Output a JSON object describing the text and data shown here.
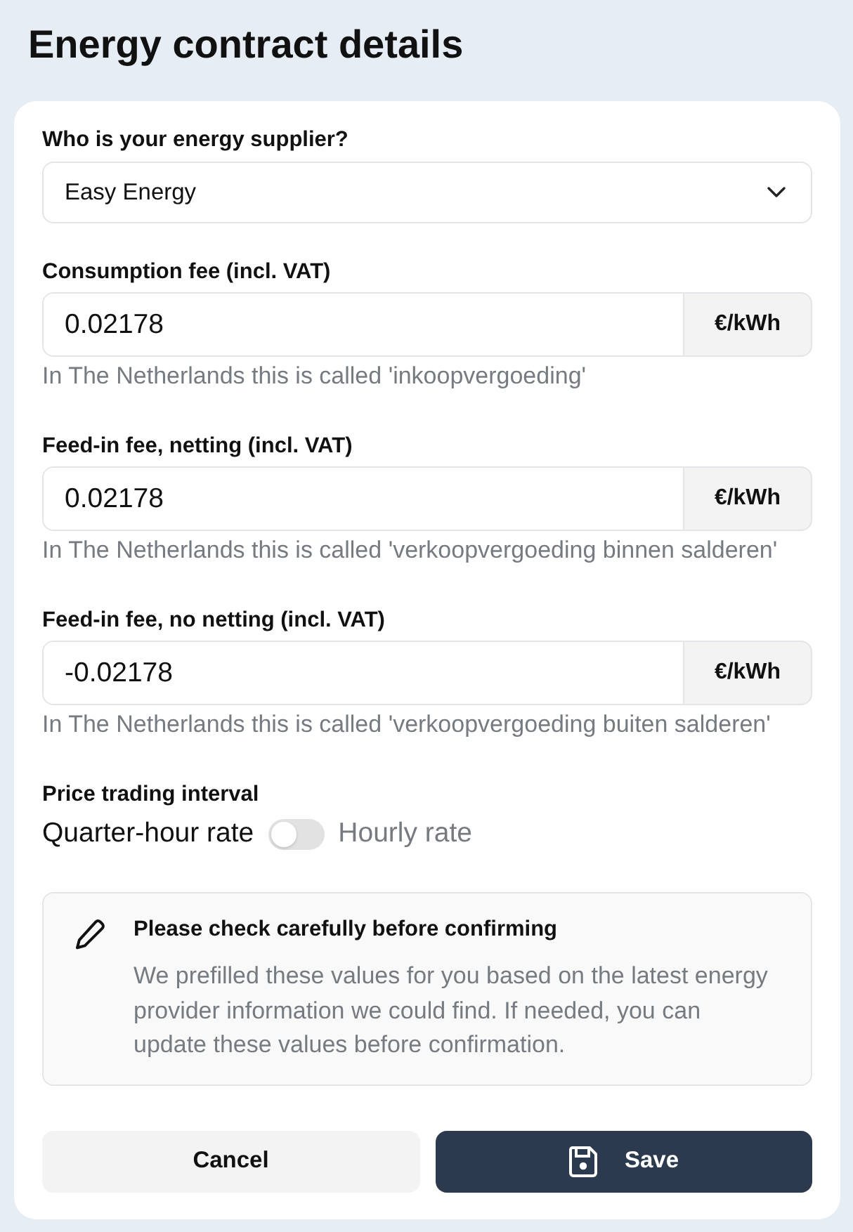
{
  "page": {
    "title": "Energy contract details"
  },
  "supplier": {
    "label": "Who is your energy supplier?",
    "value": "Easy Energy"
  },
  "fees": [
    {
      "label": "Consumption fee (incl. VAT)",
      "value": "0.02178",
      "unit": "€/kWh",
      "help": "In The Netherlands this is called 'inkoopvergoeding'"
    },
    {
      "label": "Feed-in fee, netting (incl. VAT)",
      "value": "0.02178",
      "unit": "€/kWh",
      "help": "In The Netherlands this is called 'verkoopvergoeding binnen salderen'"
    },
    {
      "label": "Feed-in fee, no netting (incl. VAT)",
      "value": "-0.02178",
      "unit": "€/kWh",
      "help": "In The Netherlands this is called 'verkoopvergoeding buiten salderen'"
    }
  ],
  "price_interval": {
    "label": "Price trading interval",
    "options": [
      {
        "label": "Quarter-hour rate",
        "selected": true
      },
      {
        "label": "Hourly rate",
        "selected": false
      }
    ]
  },
  "notice": {
    "title": "Please check carefully before confirming",
    "text": "We prefilled these values for you based on the latest energy provider information we could find. If needed, you can update these values before confirmation."
  },
  "buttons": [
    {
      "label": "Cancel",
      "kind": "secondary"
    },
    {
      "label": "Save",
      "kind": "primary"
    }
  ]
}
